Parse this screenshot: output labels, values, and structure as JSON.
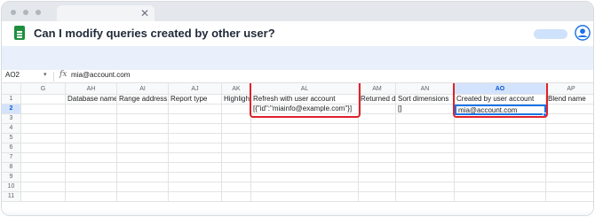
{
  "app": {
    "doc_title": "Can I modify queries created by other user?",
    "accent_color": "#1a73e8",
    "highlight_color": "#e0212a",
    "sheets_icon": "google-sheets-icon",
    "account_icon": "account-circle-icon"
  },
  "browser": {
    "tab_close_glyph": "✕"
  },
  "formula_bar": {
    "name_box": "AO2",
    "name_box_caret": "▾",
    "fx_label": "fx",
    "value": "mia@account.com"
  },
  "sheet": {
    "columns": [
      "G",
      "AH",
      "AI",
      "AJ",
      "AK",
      "AL",
      "AM",
      "AN",
      "AO",
      "AP"
    ],
    "rows": [
      "1",
      "2",
      "3",
      "4",
      "5",
      "6",
      "7",
      "8",
      "9",
      "10",
      "11"
    ],
    "headers_row1": {
      "AH": "Database name",
      "AI": "Range address (",
      "AJ": "Report type",
      "AK": "Highlight",
      "AL": "Refresh with user account",
      "AM": "Returned da",
      "AN": "Sort dimensions",
      "AO": "Created by user account",
      "AP": "Blend name"
    },
    "row2": {
      "AL": "[{\"id\":\"miainfo@example.com\"}]",
      "AN": "[]",
      "AO": "mia@account.com"
    },
    "selected_cell": "AO2"
  }
}
